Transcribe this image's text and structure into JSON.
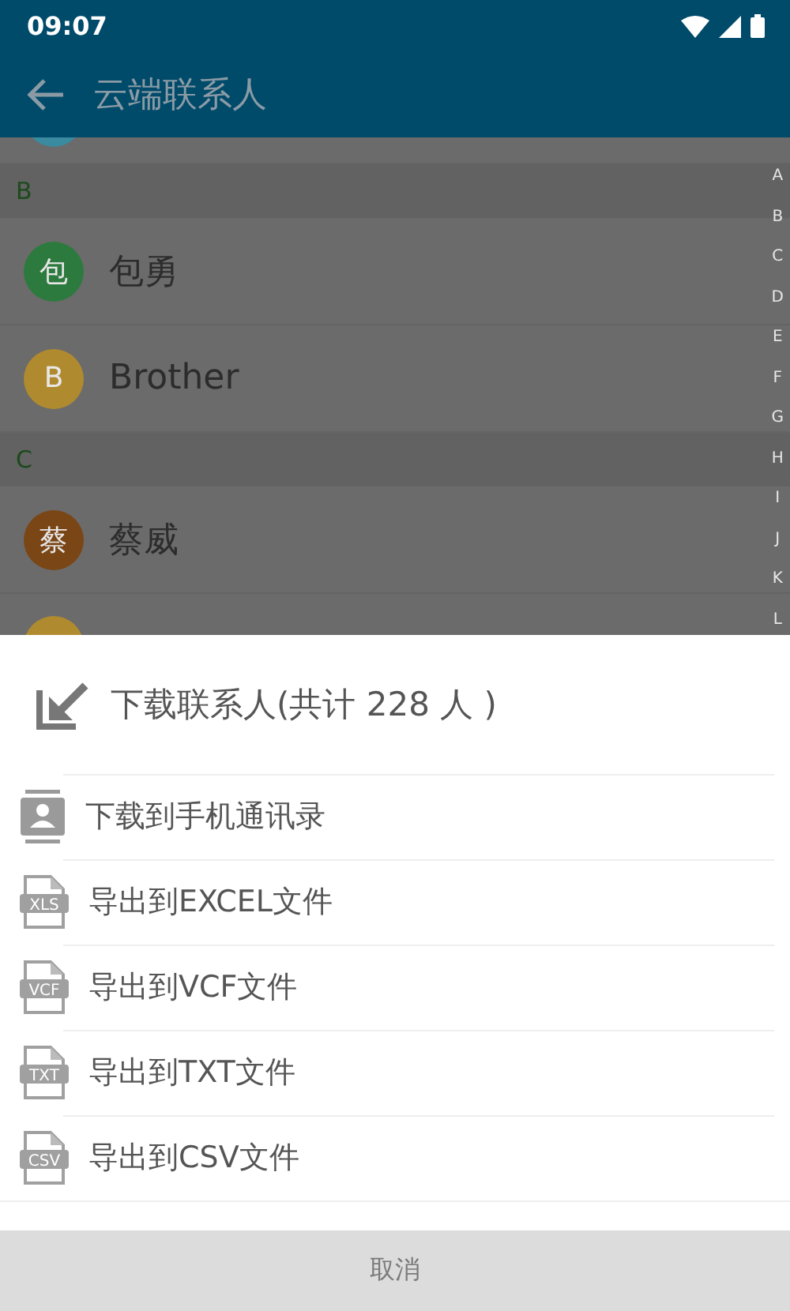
{
  "status_bar": {
    "time": "09:07"
  },
  "app_bar": {
    "title": "云端联系人"
  },
  "contacts": [
    {
      "kind": "cut_top",
      "color": "#3a8aa0"
    },
    {
      "kind": "header",
      "letter": "B"
    },
    {
      "kind": "contact",
      "avatar": "包",
      "name": "包勇",
      "color": "#2d7a3e"
    },
    {
      "kind": "contact",
      "avatar": "B",
      "name": "Brother",
      "color": "#b08a2e"
    },
    {
      "kind": "header",
      "letter": "C"
    },
    {
      "kind": "contact",
      "avatar": "蔡",
      "name": "蔡威",
      "color": "#7a4615"
    },
    {
      "kind": "cut_bottom",
      "color": "#b08a2e"
    }
  ],
  "index_letters": [
    "A",
    "B",
    "C",
    "D",
    "E",
    "F",
    "G",
    "H",
    "I",
    "J",
    "K",
    "L"
  ],
  "sheet": {
    "title": "下载联系人(共计 228 人 )",
    "options": [
      {
        "kind": "contacts",
        "label": "下载到手机通讯录"
      },
      {
        "kind": "file",
        "badge": "XLS",
        "label": "导出到EXCEL文件"
      },
      {
        "kind": "file",
        "badge": "VCF",
        "label": "导出到VCF文件"
      },
      {
        "kind": "file",
        "badge": "TXT",
        "label": "导出到TXT文件"
      },
      {
        "kind": "file",
        "badge": "CSV",
        "label": "导出到CSV文件"
      }
    ],
    "cancel": "取消"
  }
}
